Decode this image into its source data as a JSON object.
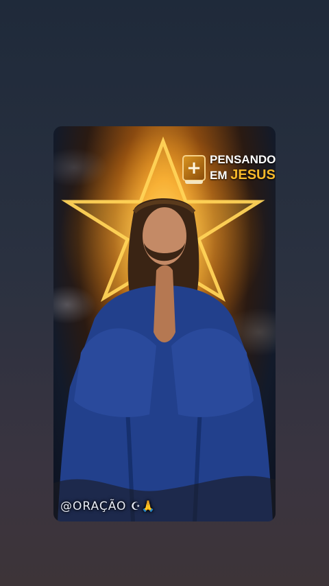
{
  "post": {
    "badge_line1": "PENSANDO",
    "badge_line2_prefix": "EM",
    "badge_line2_highlight": "JESUS",
    "badge_icon": "bible-plus-icon",
    "handle_text": "@ORAÇÃO",
    "handle_emoji": "☪🙏"
  },
  "colors": {
    "accent_gold": "#f5b82a",
    "robe_blue": "#22408c",
    "background_top": "#1f2a3a",
    "background_bottom": "#3d3438"
  }
}
